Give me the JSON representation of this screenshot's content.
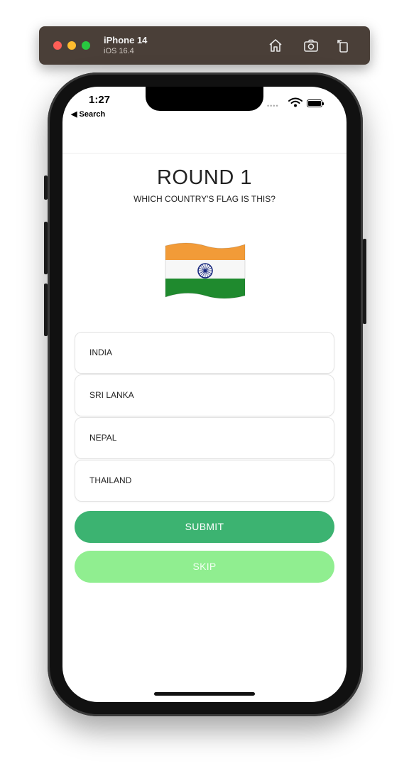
{
  "simulator": {
    "device_name": "iPhone 14",
    "os_version": "iOS 16.4",
    "icons": [
      "home-icon",
      "screenshot-icon",
      "rotate-icon"
    ]
  },
  "status_bar": {
    "time": "1:27",
    "back_label": "◀ Search",
    "signal": "••••"
  },
  "quiz": {
    "title": "ROUND 1",
    "question": "WHICH COUNTRY'S FLAG IS THIS?",
    "flag_emoji": "india-flag",
    "options": [
      "INDIA",
      "SRI LANKA",
      "NEPAL",
      "THAILAND"
    ],
    "submit_label": "SUBMIT",
    "skip_label": "SKIP"
  },
  "colors": {
    "submit": "#3cb371",
    "skip": "#90ee90",
    "saffron": "#f29b38",
    "green": "#1f8a2e",
    "chakra": "#1a2a80"
  }
}
